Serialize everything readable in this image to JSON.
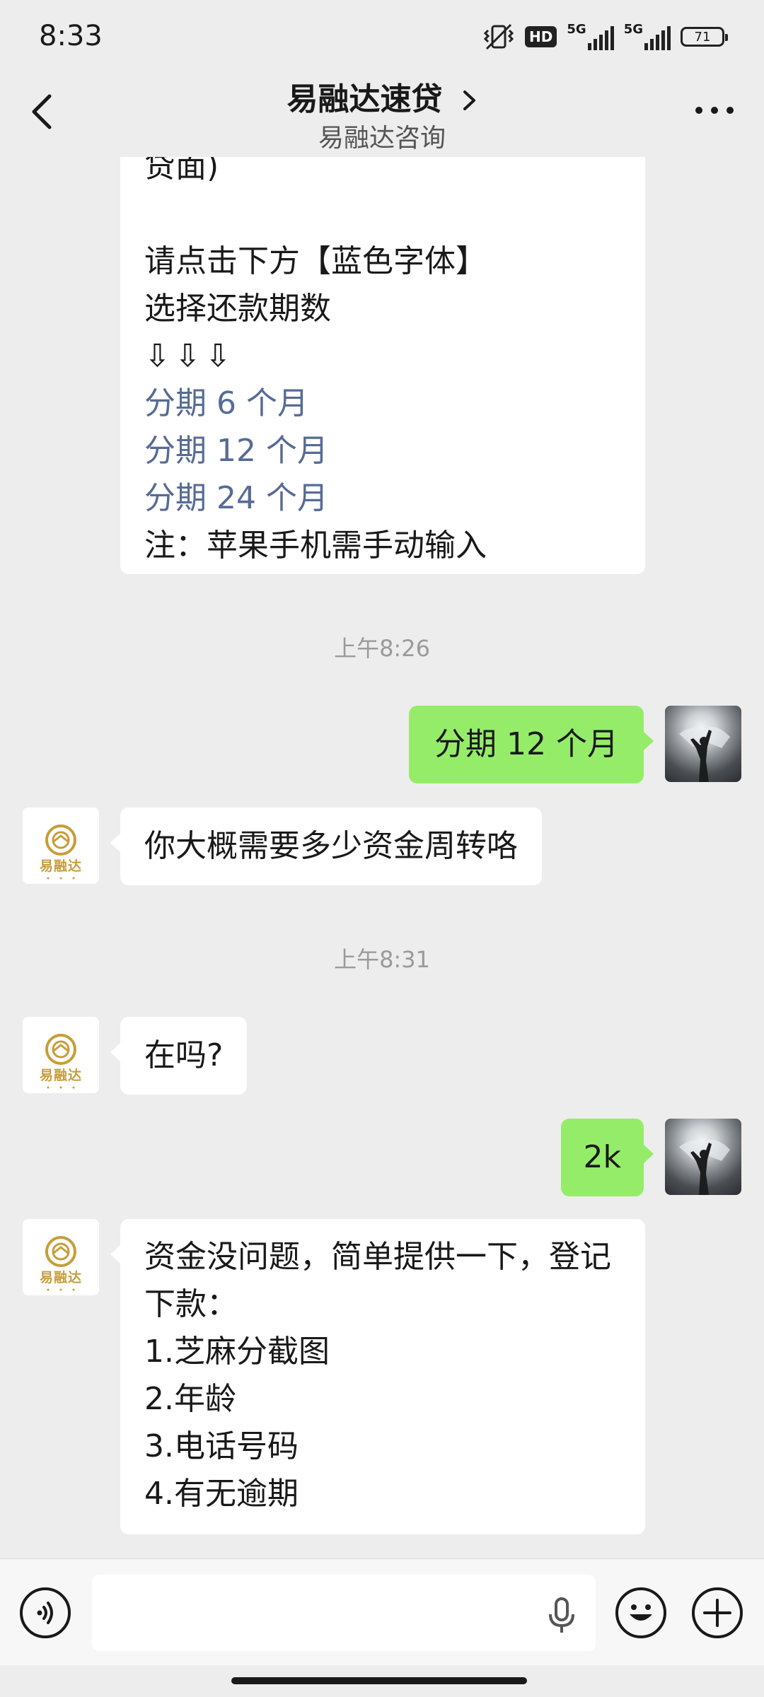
{
  "status_bar": {
    "time": "8:33",
    "hd_label": "HD",
    "network_1": "5G",
    "network_2": "5G",
    "battery": "71"
  },
  "nav": {
    "title": "易融达速贷",
    "subtitle": "易融达咨询",
    "back_icon": "chevron-left-icon",
    "more_icon": "more-dots-icon"
  },
  "messages": {
    "m1": {
      "lines": [
        "贷面)",
        "",
        "请点击下方【蓝色字体】",
        "选择还款期数",
        "⇩⇩⇩"
      ],
      "links": [
        "分期 6 个月",
        "分期 12 个月",
        "分期 24 个月"
      ],
      "note": "注：苹果手机需手动输入"
    },
    "ts1": "上午8:26",
    "m2": "分期 12 个月",
    "m3": "你大概需要多少资金周转咯",
    "ts2": "上午8:31",
    "m4": "在吗?",
    "m5": "2k",
    "m6": {
      "lines": [
        "资金没问题，简单提供一下，登记",
        "下款：",
        "1.芝麻分截图",
        "2.年龄",
        "3.电话号码",
        "4.有无逾期"
      ]
    }
  },
  "bot_avatar": {
    "text": "易融达",
    "color": "#c79d3a"
  },
  "colors": {
    "outgoing": "#95ec69",
    "incoming": "#ffffff",
    "link": "#576b95",
    "background": "#ededed"
  },
  "input_bar": {
    "value": "",
    "icons": [
      "voice-icon",
      "mic-icon",
      "emoji-icon",
      "plus-icon"
    ]
  }
}
